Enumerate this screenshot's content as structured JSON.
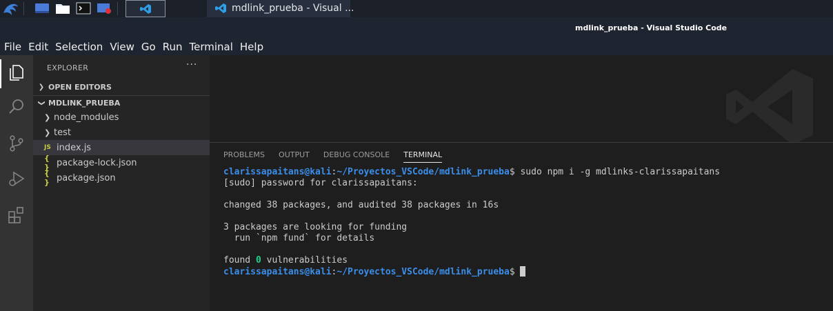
{
  "taskbar": {
    "window_title": "mdlink_prueba - Visual ..."
  },
  "window": {
    "title": "mdlink_prueba - Visual Studio Code"
  },
  "menu": [
    "File",
    "Edit",
    "Selection",
    "View",
    "Go",
    "Run",
    "Terminal",
    "Help"
  ],
  "sidebar": {
    "header": "EXPLORER",
    "more": "···",
    "open_editors": "OPEN EDITORS",
    "folder": "MDLINK_PRUEBA",
    "items": [
      {
        "label": "node_modules",
        "type": "folder"
      },
      {
        "label": "test",
        "type": "folder"
      },
      {
        "label": "index.js",
        "type": "js",
        "icon": "JS",
        "selected": true
      },
      {
        "label": "package-lock.json",
        "type": "json",
        "icon": "{ }"
      },
      {
        "label": "package.json",
        "type": "json",
        "icon": "{ }"
      }
    ]
  },
  "panel": {
    "tabs": [
      "PROBLEMS",
      "OUTPUT",
      "DEBUG CONSOLE",
      "TERMINAL"
    ],
    "active_tab": "TERMINAL"
  },
  "terminal": {
    "user_host": "clarissapaitans@kali",
    "colon": ":",
    "path": "~/Proyectos_VSCode/mdlink_prueba",
    "prompt_symbol": "$",
    "command": " sudo npm i -g mdlinks-clarissapaitans",
    "line_sudo": "[sudo] password for clarissapaitans:",
    "line_changed": "changed 38 packages, and audited 38 packages in 16s",
    "line_funding": "3 packages are looking for funding",
    "line_fund_cmd": "  run `npm fund` for details",
    "line_found_prefix": "found ",
    "line_found_count": "0",
    "line_found_suffix": " vulnerabilities"
  },
  "colors": {
    "activity_bar": "#333333",
    "sidebar": "#252526",
    "editor": "#1e1e1e",
    "terminal_blue": "#3b8eea",
    "terminal_green": "#23d18b"
  }
}
